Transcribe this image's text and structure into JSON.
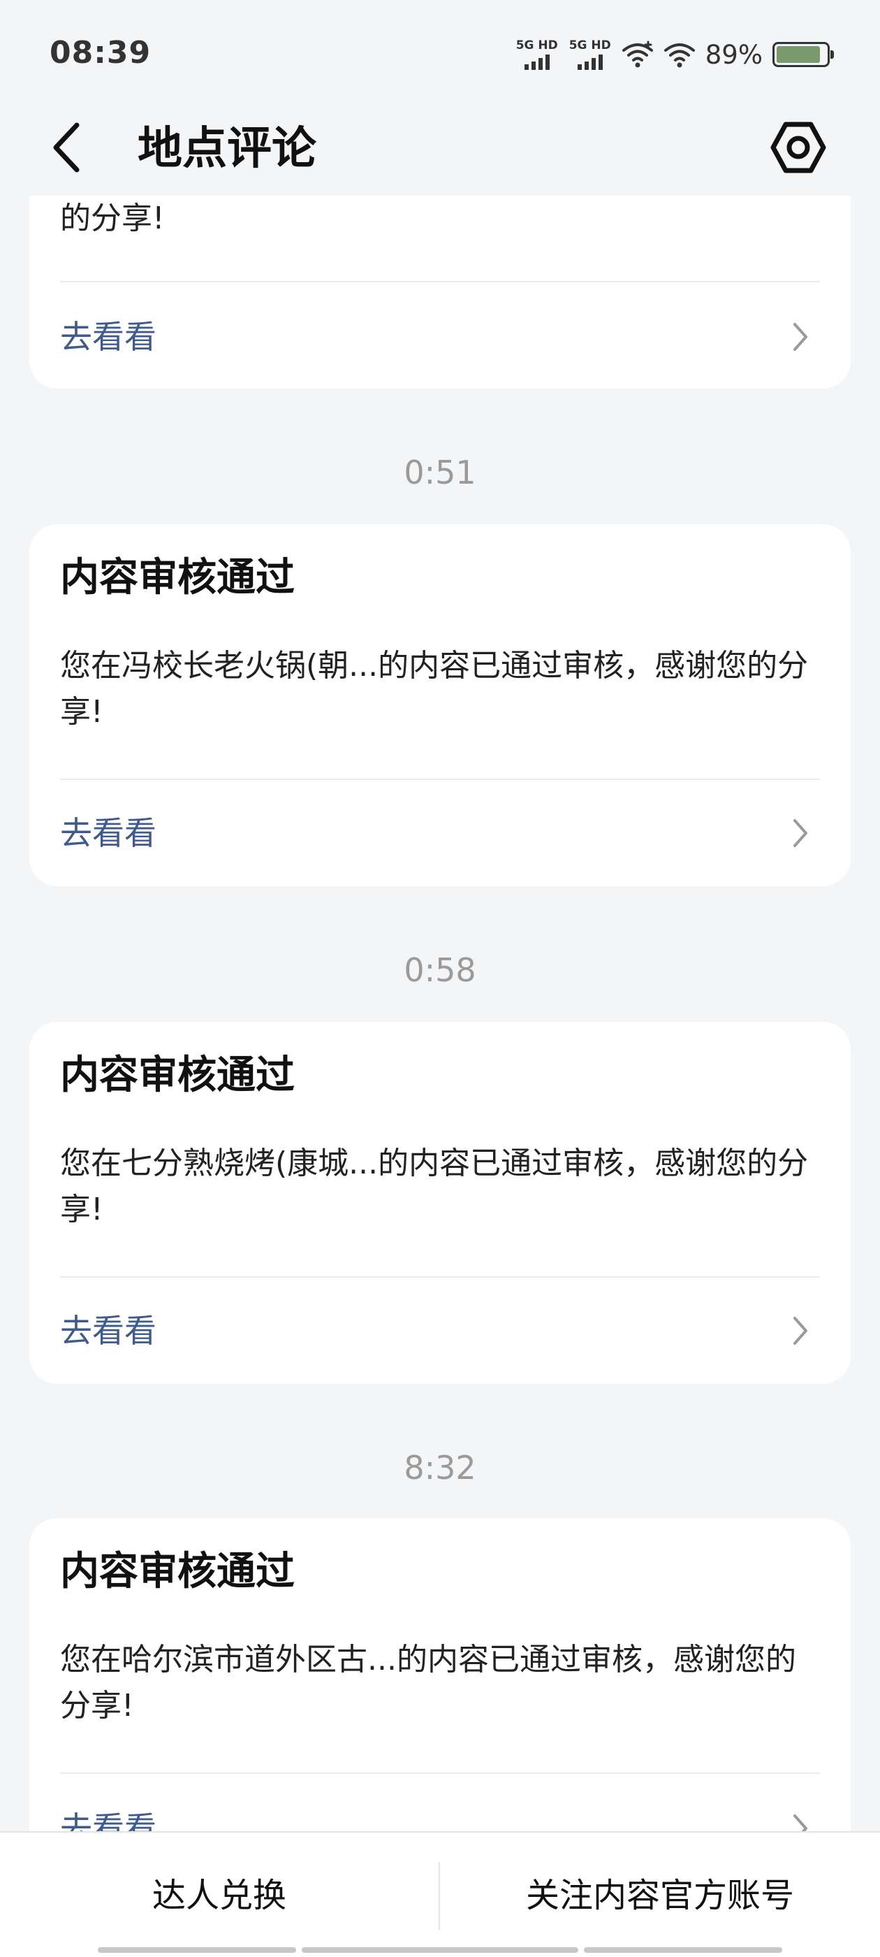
{
  "status_bar": {
    "time": "08:39",
    "sim1_label": "5G HD",
    "sim2_label": "5G HD",
    "battery_percent": "89%",
    "battery_level": 0.89
  },
  "header": {
    "title": "地点评论",
    "back_icon": "chevron-left-icon",
    "settings_icon": "hexagon-settings-icon"
  },
  "feed": {
    "first_partial": {
      "text": "的分享!",
      "link": "去看看"
    },
    "items": [
      {
        "time": "0:51",
        "title": "内容审核通过",
        "text": "您在冯校长老火锅(朝...的内容已通过审核，感谢您的分享!",
        "link": "去看看"
      },
      {
        "time": "0:58",
        "title": "内容审核通过",
        "text": "您在七分熟烧烤(康城...的内容已通过审核，感谢您的分享!",
        "link": "去看看"
      },
      {
        "time": "8:32",
        "title": "内容审核通过",
        "text": "您在哈尔滨市道外区古...的内容已通过审核，感谢您的分享!",
        "link": "去看看"
      }
    ]
  },
  "bottom_bar": {
    "left_label": "达人兑换",
    "right_label": "关注内容官方账号"
  },
  "colors": {
    "background": "#f4f5f7",
    "card": "#ffffff",
    "link": "#3e5b8c",
    "timestamp": "#9a9a9a"
  }
}
